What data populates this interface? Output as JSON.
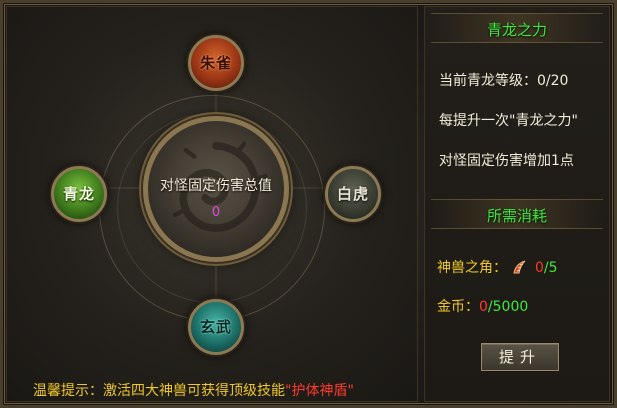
{
  "beasts": {
    "zhuque": "朱雀",
    "qinglong": "青龙",
    "baihu": "白虎",
    "xuanwu": "玄武"
  },
  "center": {
    "title": "对怪固定伤害总值",
    "value": "0"
  },
  "tip": {
    "prefix": "温馨提示：激活四大神兽可获得顶级技能",
    "highlight": "\"护体神盾\""
  },
  "panel": {
    "title": "青龙之力",
    "level_line": "当前青龙等级：0/20",
    "desc1": "每提升一次\"青龙之力\"",
    "desc2": "对怪固定伤害增加1点",
    "cost_title": "所需消耗",
    "cost": {
      "item_label": "神兽之角：",
      "item_have": "0",
      "item_sep": "/",
      "item_need": "5",
      "gold_label": "金币：",
      "gold_have": "0",
      "gold_sep": "/",
      "gold_need": "5000"
    },
    "button": "提升"
  },
  "colors": {
    "title_green": "#3ee83e",
    "accent_yellow": "#f0c828",
    "accent_red": "#ff3a2a",
    "value_magenta": "#e24bd8"
  },
  "icons": {
    "item": "beast-horn-icon"
  }
}
